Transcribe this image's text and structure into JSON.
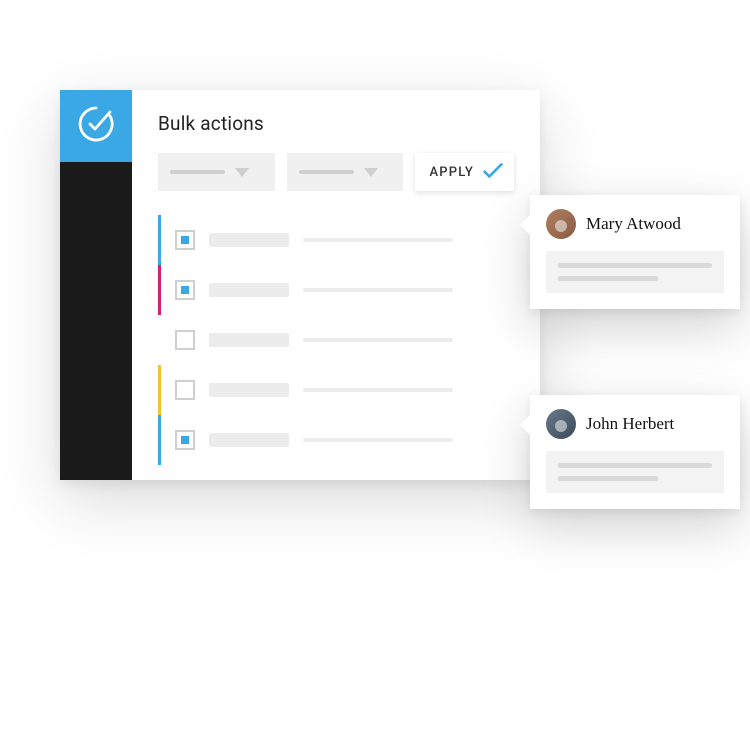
{
  "header": {
    "title": "Bulk actions"
  },
  "controls": {
    "apply_label": "APPLY"
  },
  "rows": [
    {
      "checked": true,
      "color": "blue"
    },
    {
      "checked": true,
      "color": "magenta"
    },
    {
      "checked": false,
      "color": "none"
    },
    {
      "checked": false,
      "color": "yellow"
    },
    {
      "checked": true,
      "color": "blue"
    }
  ],
  "popovers": [
    {
      "name": "Mary Atwood"
    },
    {
      "name": "John Herbert"
    }
  ],
  "colors": {
    "brand": "#3ba8e6",
    "magenta": "#d6226b",
    "yellow": "#f2c230",
    "sidebar": "#1a1a1a"
  }
}
